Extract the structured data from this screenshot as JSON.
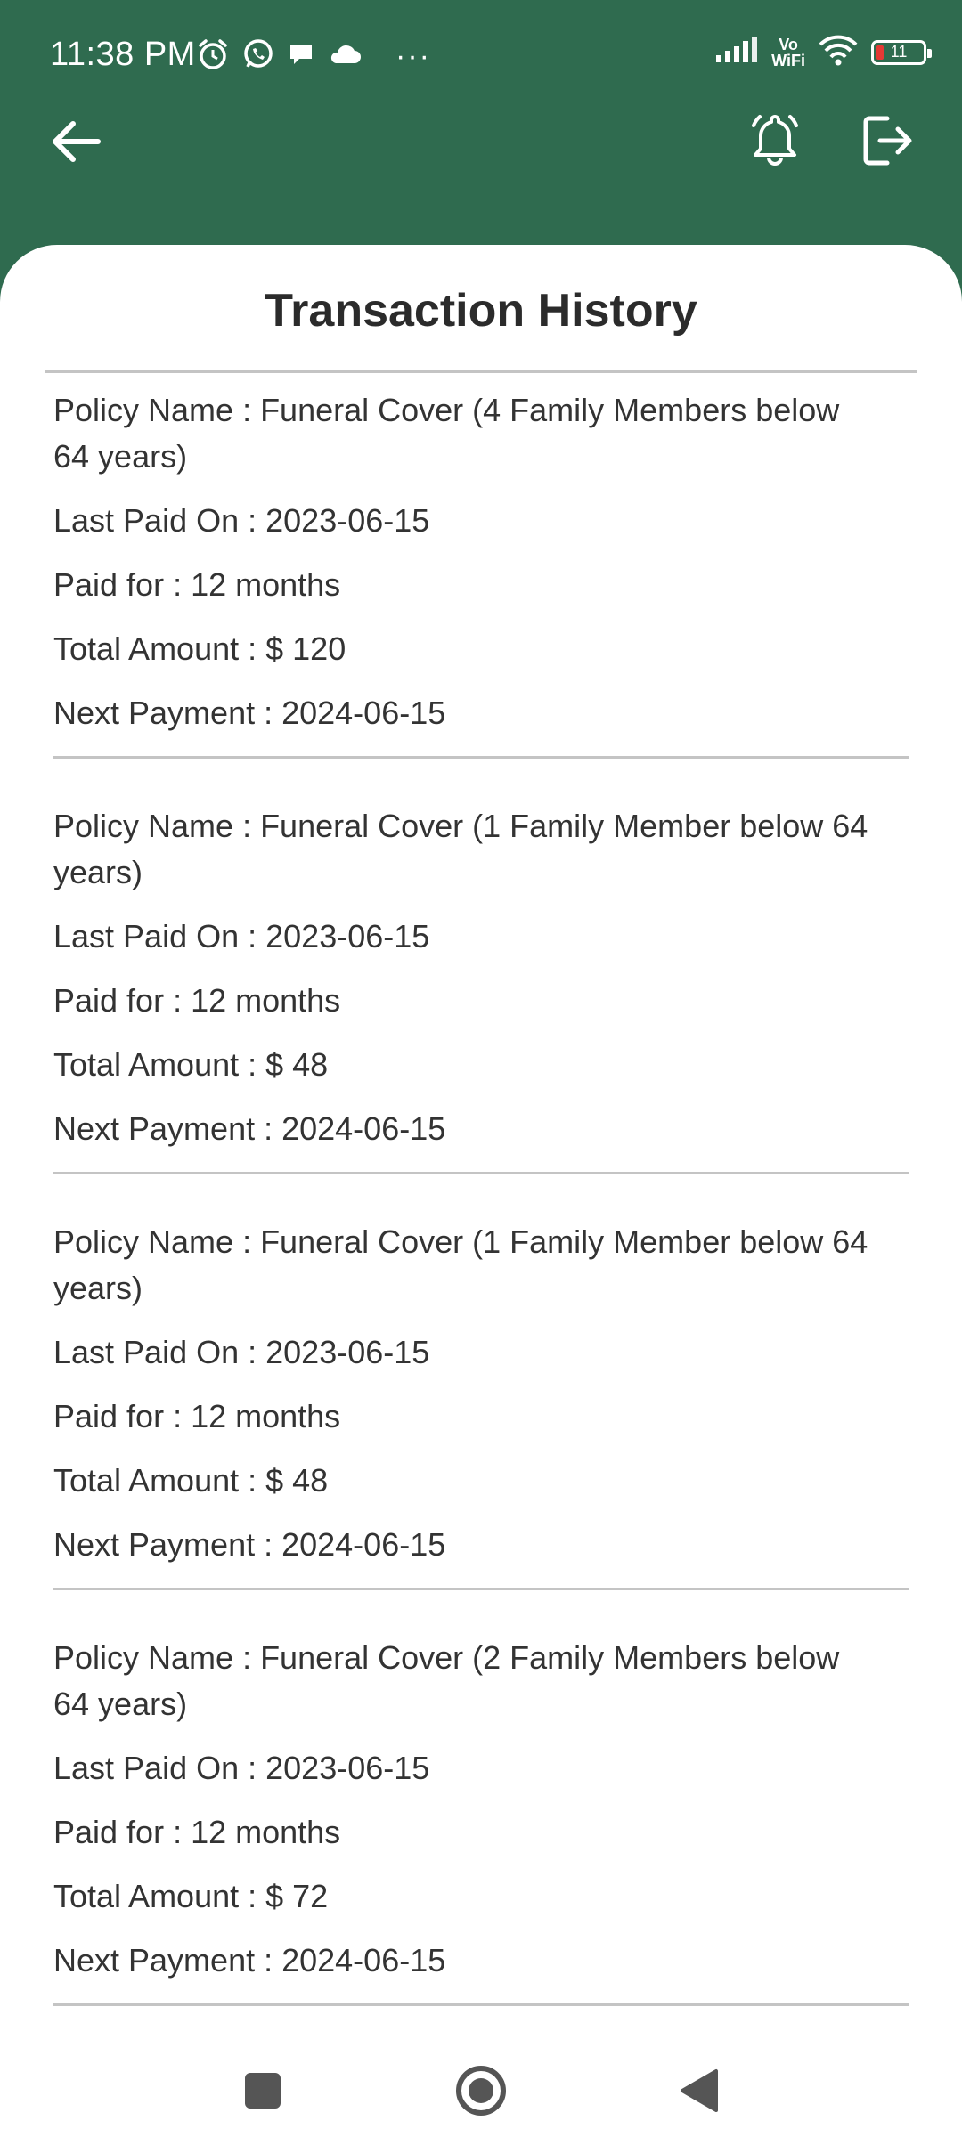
{
  "status_bar": {
    "time": "11:38 PM",
    "more": "···",
    "vowifi_top": "Vo",
    "vowifi_bottom": "WiFi",
    "battery": "11",
    "icons": [
      "alarm-icon",
      "whatsapp-icon",
      "chat-icon",
      "cloud-icon",
      "signal-icon",
      "wifi-icon",
      "battery-icon"
    ]
  },
  "header": {
    "back_icon": "arrow-left-icon",
    "notification_icon": "bell-icon",
    "logout_icon": "logout-icon",
    "background_color": "#2f6b4f"
  },
  "page": {
    "title": "Transaction History"
  },
  "transactions": [
    {
      "policy": "Policy Name : Funeral Cover (4 Family Members below 64 years)",
      "last_paid": "Last Paid On : 2023-06-15",
      "paid_for": "Paid for : 12 months",
      "total": "Total Amount : $ 120",
      "next": "Next Payment : 2024-06-15"
    },
    {
      "policy": "Policy Name : Funeral Cover (1 Family Member below 64 years)",
      "last_paid": "Last Paid On : 2023-06-15",
      "paid_for": "Paid for : 12 months",
      "total": "Total Amount : $ 48",
      "next": "Next Payment : 2024-06-15"
    },
    {
      "policy": "Policy Name : Funeral Cover (1 Family Member below 64 years)",
      "last_paid": "Last Paid On : 2023-06-15",
      "paid_for": "Paid for : 12 months",
      "total": "Total Amount : $ 48",
      "next": "Next Payment : 2024-06-15"
    },
    {
      "policy": "Policy Name : Funeral Cover (2 Family Members below 64 years)",
      "last_paid": "Last Paid On : 2023-06-15",
      "paid_for": "Paid for : 12 months",
      "total": "Total Amount : $ 72",
      "next": "Next Payment : 2024-06-15"
    }
  ],
  "system_nav": {
    "recents_icon": "square-icon",
    "home_icon": "circle-icon",
    "back_icon": "triangle-back-icon"
  }
}
